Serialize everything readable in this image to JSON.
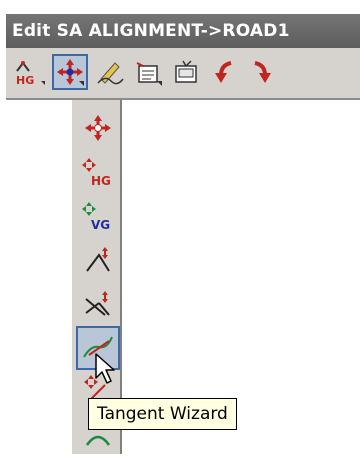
{
  "window": {
    "title": "Edit SA ALIGNMENT->ROAD1"
  },
  "toolbar": {
    "buttons": [
      {
        "icon": "hg-alignment-icon",
        "selected": false
      },
      {
        "icon": "move-icon",
        "selected": true
      },
      {
        "icon": "edit-pen-icon",
        "selected": false
      },
      {
        "icon": "report-icon",
        "selected": false
      },
      {
        "icon": "display-icon",
        "selected": false
      },
      {
        "icon": "undo-arrow-icon",
        "selected": false
      },
      {
        "icon": "redo-arrow-icon",
        "selected": false
      }
    ],
    "icon_labels": {
      "hg": "HG"
    }
  },
  "dropdown": {
    "items": [
      {
        "icon": "move-arrows-icon"
      },
      {
        "icon": "move-hg-icon",
        "label": "HG"
      },
      {
        "icon": "move-vg-icon",
        "label": "VG"
      },
      {
        "icon": "angle-pi-icon"
      },
      {
        "icon": "intersection-pi-icon"
      },
      {
        "icon": "tangent-wizard-icon",
        "hovered": true
      },
      {
        "icon": "insert-pi-icon"
      },
      {
        "icon": "arc-icon"
      }
    ]
  },
  "tooltip": {
    "text": "Tangent Wizard"
  },
  "colors": {
    "titlebar": "#666666",
    "toolbar": "#d6d3ce",
    "selection_border": "#3d6aa4",
    "selection_fill": "#b9c6d8",
    "tooltip_bg": "#ffffe1",
    "icon_red": "#c0261f",
    "icon_blue": "#1f2fa0",
    "icon_green": "#1e8a3c"
  }
}
